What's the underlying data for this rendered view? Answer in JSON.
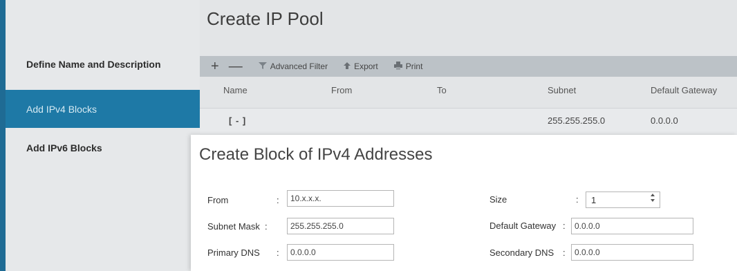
{
  "sidebar": {
    "items": [
      {
        "label": "Define Name and Description"
      },
      {
        "label": "Add IPv4 Blocks"
      },
      {
        "label": "Add IPv6 Blocks"
      }
    ]
  },
  "main": {
    "title": "Create IP Pool",
    "toolbar": {
      "add_label": "+",
      "remove_label": "—",
      "advanced_filter_label": "Advanced Filter",
      "export_label": "Export",
      "print_label": "Print"
    },
    "table": {
      "columns": [
        "Name",
        "From",
        "To",
        "Subnet",
        "Default Gateway"
      ],
      "rows": [
        {
          "name": "[ - ]",
          "from": "",
          "to": "",
          "subnet": "255.255.255.0",
          "gateway": "0.0.0.0"
        }
      ]
    }
  },
  "dialog": {
    "title": "Create Block of IPv4 Addresses",
    "fields": {
      "from": {
        "label": "From",
        "value": "10.x.x.x."
      },
      "subnet_mask": {
        "label": "Subnet Mask",
        "value": "255.255.255.0"
      },
      "primary_dns": {
        "label": "Primary DNS",
        "value": "0.0.0.0"
      },
      "size": {
        "label": "Size",
        "value": "1"
      },
      "default_gateway": {
        "label": "Default Gateway",
        "value": "0.0.0.0"
      },
      "secondary_dns": {
        "label": "Secondary DNS",
        "value": "0.0.0.0"
      }
    },
    "colon": ":"
  },
  "colors": {
    "accent": "#1e79a6",
    "sidebar_bg": "#e6e8ea",
    "toolbar_bg": "#bcc2c7"
  },
  "icons": {
    "filter": "filter-icon",
    "export": "export-arrow-icon",
    "print": "printer-icon"
  }
}
